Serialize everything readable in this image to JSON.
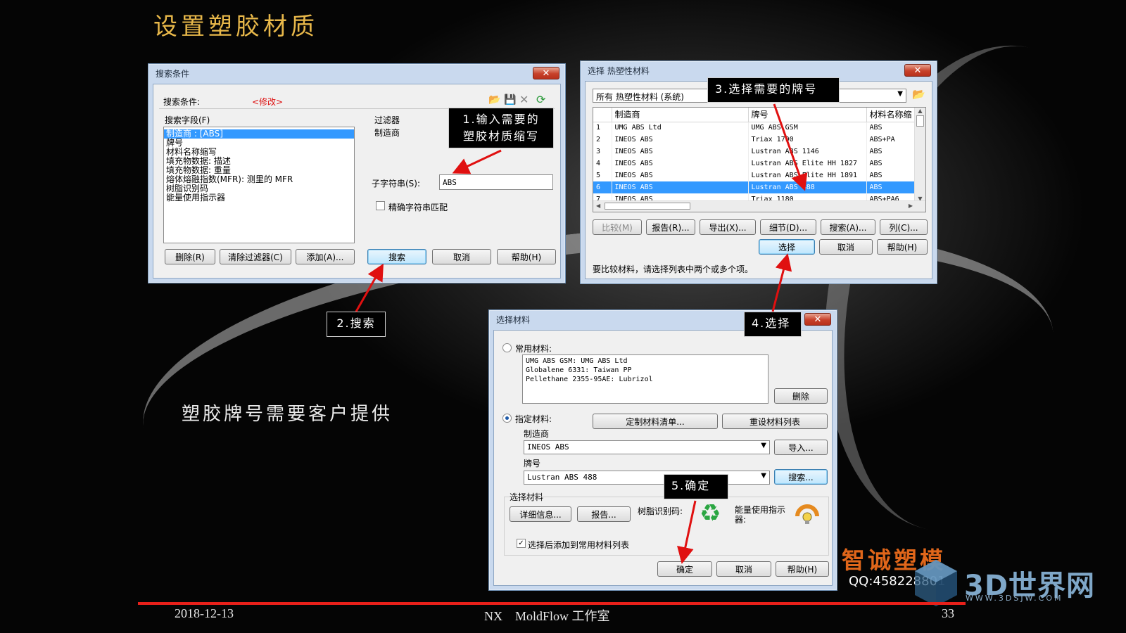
{
  "slide": {
    "title": "设置塑胶材质",
    "note": "塑胶牌号需要客户提供",
    "footer": {
      "date": "2018-12-13",
      "center": "NX    MoldFlow 工作室",
      "page": "33"
    },
    "brand": "智诚塑模",
    "qq": "QQ:458228801",
    "watermark": {
      "name": "3D世界网",
      "url": "WWW.3DSJW.COM"
    },
    "colors": {
      "title": "#e8b84a",
      "footer_line": "#e8201a",
      "brand": "#e0661a",
      "selection": "#3399ff"
    }
  },
  "search_dialog": {
    "title": "搜索条件",
    "criteria_label": "搜索条件:",
    "criteria_value": "<修改>",
    "fields_label": "搜索字段(F)",
    "fields": [
      "制造商 : [ABS]",
      "牌号",
      "材料名称缩写",
      "填充物数据: 描述",
      "填充物数据: 重量",
      "熔体熔融指数(MFR): 测里的 MFR",
      "树脂识别码",
      "能量使用指示器"
    ],
    "filter_label": "过滤器",
    "filter_field": "制造商",
    "substring_label": "子字符串(S):",
    "substring_value": "ABS",
    "exact_match_label": "精确字符串匹配",
    "buttons": {
      "delete": "删除(R)",
      "clear": "清除过滤器(C)",
      "add": "添加(A)...",
      "search": "搜索",
      "cancel": "取消",
      "help": "帮助(H)"
    }
  },
  "thermoplastic_dialog": {
    "title": "选择 热塑性材料",
    "source_combo": "所有 热塑性材料 (系统)",
    "columns": [
      "",
      "制造商",
      "牌号",
      "材料名称缩"
    ],
    "rows": [
      [
        "1",
        "UMG ABS Ltd",
        "UMG ABS GSM",
        "ABS"
      ],
      [
        "2",
        "INEOS ABS",
        "Triax 1790",
        "ABS+PA"
      ],
      [
        "3",
        "INEOS ABS",
        "Lustran ABS 1146",
        "ABS"
      ],
      [
        "4",
        "INEOS ABS",
        "Lustran ABS Elite HH 1827",
        "ABS"
      ],
      [
        "5",
        "INEOS ABS",
        "Lustran ABS Elite HH 1891",
        "ABS"
      ],
      [
        "6",
        "INEOS ABS",
        "Lustran ABS 488",
        "ABS"
      ],
      [
        "7",
        "INEOS ABS",
        "Triax 1180",
        "ABS+PA6"
      ]
    ],
    "selected_row": 5,
    "buttons": {
      "compare": "比较(M)",
      "report": "报告(R)...",
      "export": "导出(X)...",
      "details": "细节(D)...",
      "search": "搜索(A)...",
      "columns": "列(C)...",
      "select": "选择",
      "cancel": "取消",
      "help": "帮助(H)"
    },
    "status": "要比较材料，请选择列表中两个或多个项。"
  },
  "select_material_dialog": {
    "title": "选择材料",
    "common_label": "常用材料:",
    "common_items": [
      "UMG ABS GSM: UMG ABS Ltd",
      "Globalene 6331: Taiwan PP",
      "Pellethane 2355-95AE: Lubrizol"
    ],
    "delete": "删除",
    "specified_label": "指定材料:",
    "custom_list": "定制材料清单...",
    "reset_list": "重设材料列表",
    "manufacturer_label": "制造商",
    "manufacturer_value": "INEOS ABS",
    "import": "导入...",
    "grade_label": "牌号",
    "grade_value": "Lustran ABS 488",
    "search": "搜索...",
    "selected_group": "选择材料",
    "details": "详细信息...",
    "report": "报告...",
    "resin_code_label": "树脂识别码:",
    "energy_label": "能量使用指示器:",
    "add_to_common": "选择后添加到常用材料列表",
    "ok": "确定",
    "cancel": "取消",
    "help": "帮助(H)"
  },
  "callouts": {
    "step1": [
      "1.输入需要的",
      "塑胶材质缩写"
    ],
    "step2": "2.搜索",
    "step3": "3.选择需要的牌号",
    "step4": "4.选择",
    "step5": "5.确定"
  }
}
